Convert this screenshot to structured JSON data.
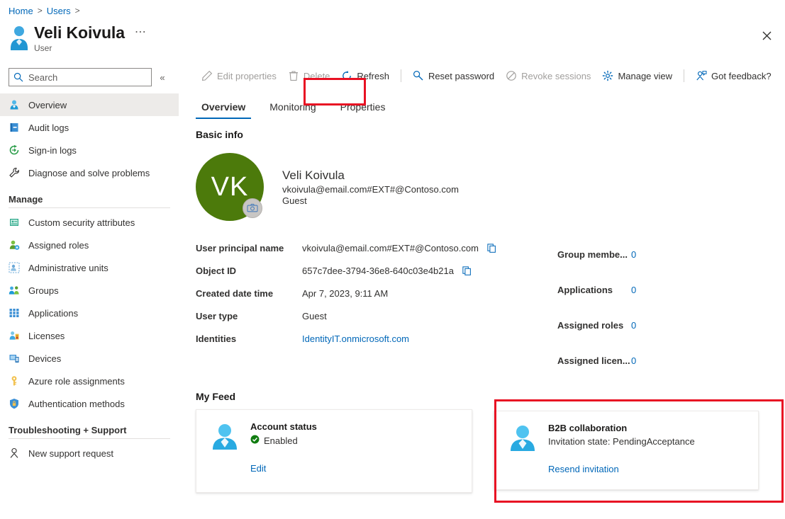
{
  "breadcrumb": {
    "items": [
      "Home",
      "Users"
    ],
    "separator": ">"
  },
  "header": {
    "title": "Veli Koivula",
    "subtitle": "User",
    "more_label": "⋯",
    "close_label": "✕",
    "user_icon": "user-icon"
  },
  "sidebar": {
    "search": {
      "placeholder": "Search",
      "value": "",
      "icon": "search-icon"
    },
    "collapse_label": "«",
    "items": [
      {
        "label": "Overview",
        "icon": "user-overview-icon",
        "selected": true
      },
      {
        "label": "Audit logs",
        "icon": "audit-logs-icon",
        "selected": false
      },
      {
        "label": "Sign-in logs",
        "icon": "sign-in-logs-icon",
        "selected": false
      },
      {
        "label": "Diagnose and solve problems",
        "icon": "wrench-icon",
        "selected": false
      }
    ],
    "group_manage": "Manage",
    "manage_items": [
      {
        "label": "Custom security attributes",
        "icon": "custom-security-attributes-icon"
      },
      {
        "label": "Assigned roles",
        "icon": "assigned-roles-icon"
      },
      {
        "label": "Administrative units",
        "icon": "administrative-units-icon"
      },
      {
        "label": "Groups",
        "icon": "groups-icon"
      },
      {
        "label": "Applications",
        "icon": "applications-grid-icon"
      },
      {
        "label": "Licenses",
        "icon": "licenses-icon"
      },
      {
        "label": "Devices",
        "icon": "devices-icon"
      },
      {
        "label": "Azure role assignments",
        "icon": "key-icon"
      },
      {
        "label": "Authentication methods",
        "icon": "shield-lock-icon"
      }
    ],
    "group_support": "Troubleshooting + Support",
    "support_items": [
      {
        "label": "New support request",
        "icon": "support-person-icon"
      }
    ]
  },
  "toolbar": {
    "buttons": [
      {
        "label": "Edit properties",
        "icon": "pencil-icon",
        "disabled": true
      },
      {
        "label": "Delete",
        "icon": "trash-icon",
        "disabled": true
      },
      {
        "label": "Refresh",
        "icon": "refresh-icon",
        "disabled": false
      },
      {
        "label": "Reset password",
        "icon": "key-reset-icon",
        "disabled": false
      },
      {
        "label": "Revoke sessions",
        "icon": "block-icon",
        "disabled": true
      },
      {
        "label": "Manage view",
        "icon": "gear-icon",
        "disabled": false
      },
      {
        "label": "Got feedback?",
        "icon": "feedback-person-icon",
        "disabled": false
      }
    ]
  },
  "tabs": [
    {
      "label": "Overview",
      "active": true
    },
    {
      "label": "Monitoring",
      "active": false
    },
    {
      "label": "Properties",
      "active": false,
      "highlighted": true
    }
  ],
  "basic_info": {
    "heading": "Basic info",
    "avatar_initials": "VK",
    "avatar_color": "#4c7a0b",
    "camera_icon": "camera-icon",
    "name": "Veli Koivula",
    "upn": "vkoivula@email.com#EXT#@Contoso.com",
    "user_type": "Guest"
  },
  "details": {
    "left": [
      {
        "label": "User principal name",
        "value": "vkoivula@email.com#EXT#@Contoso.com",
        "copy": true,
        "link": false
      },
      {
        "label": "Object ID",
        "value": "657c7dee-3794-36e8-640c03e4b21a",
        "copy": true,
        "link": false
      },
      {
        "label": "Created date time",
        "value": "Apr 7, 2023, 9:11 AM",
        "copy": false,
        "link": false
      },
      {
        "label": "User type",
        "value": "Guest",
        "copy": false,
        "link": false
      },
      {
        "label": "Identities",
        "value": "IdentityIT.onmicrosoft.com",
        "copy": false,
        "link": true
      }
    ],
    "right": [
      {
        "label": "Group membe...",
        "count": "0"
      },
      {
        "label": "Applications",
        "count": "0"
      },
      {
        "label": "Assigned roles",
        "count": "0"
      },
      {
        "label": "Assigned licen...",
        "count": "0"
      }
    ],
    "copy_icon": "copy-icon"
  },
  "my_feed": {
    "heading": "My Feed",
    "account_status": {
      "icon": "person-avatar-icon",
      "title": "Account status",
      "status": "Enabled",
      "status_icon": "check-circle-icon",
      "status_color": "#107c10",
      "link": "Edit"
    },
    "b2b": {
      "icon": "person-avatar-icon",
      "title": "B2B collaboration",
      "subtitle": "Invitation state: PendingAcceptance",
      "link": "Resend invitation"
    }
  },
  "highlight_color": "#e81123"
}
